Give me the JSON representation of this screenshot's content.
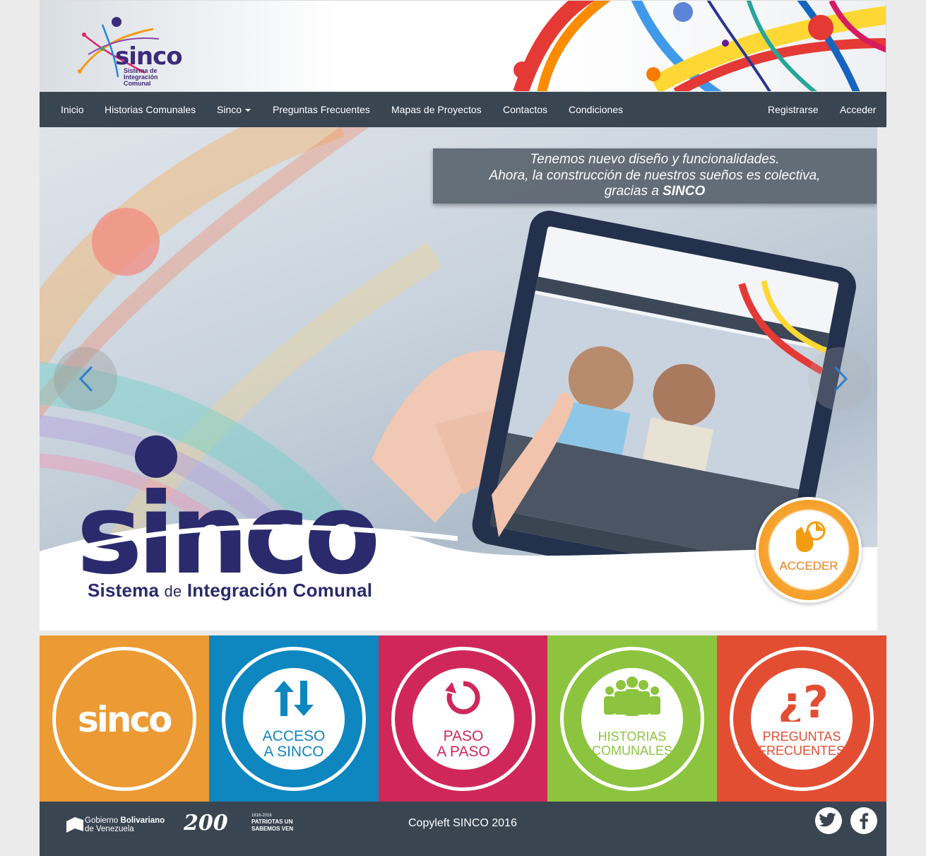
{
  "header": {
    "logo": {
      "brand": "sinco",
      "tagline_lines": [
        "Sistema de",
        "Integración",
        "Comunal"
      ]
    }
  },
  "navbar": {
    "items": [
      {
        "label": "Inicio"
      },
      {
        "label": "Historias Comunales"
      },
      {
        "label": "Sinco",
        "dropdown": true
      },
      {
        "label": "Preguntas Frecuentes"
      },
      {
        "label": "Mapas de Proyectos"
      },
      {
        "label": "Contactos"
      },
      {
        "label": "Condiciones"
      }
    ],
    "right_items": [
      {
        "label": "Registrarse"
      },
      {
        "label": "Acceder"
      }
    ]
  },
  "carousel": {
    "caption_lines": [
      "Tenemos nuevo diseño y funcionalidades.",
      "Ahora, la construcción de nuestros sueños es colectiva,"
    ],
    "caption_line3_prefix": "gracias a ",
    "caption_brand": "SINCO",
    "title": "sinco",
    "subtitle_parts": [
      "Sistema ",
      "de",
      " Integración Comunal"
    ],
    "acceder_label": "ACCEDER",
    "prev_icon": "chevron-left-icon",
    "next_icon": "chevron-right-icon"
  },
  "tiles": [
    {
      "lines": [
        "sinco"
      ],
      "color": "#ec9a34",
      "icon": "sinco-wordmark"
    },
    {
      "lines": [
        "ACCESO",
        "A SINCO"
      ],
      "color": "#0e86c0",
      "icon": "arrows-up-down-icon"
    },
    {
      "lines": [
        "PASO",
        "A PASO"
      ],
      "color": "#d0275a",
      "icon": "refresh-cycle-icon"
    },
    {
      "lines": [
        "HISTORIAS",
        "COMUNALES"
      ],
      "color": "#8cc43f",
      "icon": "people-group-icon"
    },
    {
      "lines": [
        "PREGUNTAS",
        "FRECUENTES"
      ],
      "color": "#e34e33",
      "icon": "question-mark-icon"
    }
  ],
  "footer": {
    "gov_logo": {
      "line1_a": "Gobierno ",
      "line1_b": "Bolivariano",
      "line2": "de Venezuela"
    },
    "bicentenario": {
      "num": "200",
      "years": "1816-2016",
      "line1": "PATRIOTAS UNIDOS",
      "line2": "SABEMOS VENCER"
    },
    "copyleft": "Copyleft SINCO 2016",
    "social": [
      "twitter-icon",
      "facebook-icon"
    ]
  }
}
